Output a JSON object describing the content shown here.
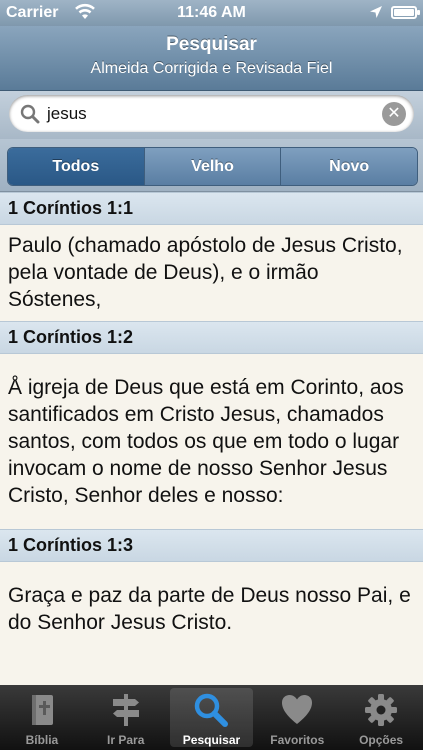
{
  "status": {
    "carrier": "Carrier",
    "time": "11:46 AM"
  },
  "navbar": {
    "title": "Pesquisar",
    "subtitle": "Almeida Corrigida e Revisada Fiel"
  },
  "search": {
    "query": "jesus"
  },
  "scope": {
    "tabs": [
      "Todos",
      "Velho",
      "Novo"
    ],
    "selected": "Todos"
  },
  "results": [
    {
      "reference": "1 Coríntios 1:1",
      "text": "Paulo (chamado apóstolo de Jesus Cristo, pela vontade de Deus), e o irmão Sóstenes,"
    },
    {
      "reference": "1 Coríntios 1:2",
      "text": "Å igreja de Deus que está em Corinto, aos santificados em Cristo Jesus, chamados santos, com todos os que em todo o lugar invocam o nome de nosso Senhor Jesus Cristo, Senhor deles e nosso:"
    },
    {
      "reference": "1 Coríntios 1:3",
      "text": "Graça e paz da parte de Deus nosso Pai, e do Senhor Jesus Cristo."
    }
  ],
  "tabbar": {
    "items": [
      {
        "label": "Bíblia",
        "icon": "bible-icon"
      },
      {
        "label": "Ir Para",
        "icon": "signpost-icon"
      },
      {
        "label": "Pesquisar",
        "icon": "search-icon"
      },
      {
        "label": "Favoritos",
        "icon": "heart-icon"
      },
      {
        "label": "Opções",
        "icon": "gear-icon"
      }
    ],
    "selected": "Pesquisar"
  }
}
